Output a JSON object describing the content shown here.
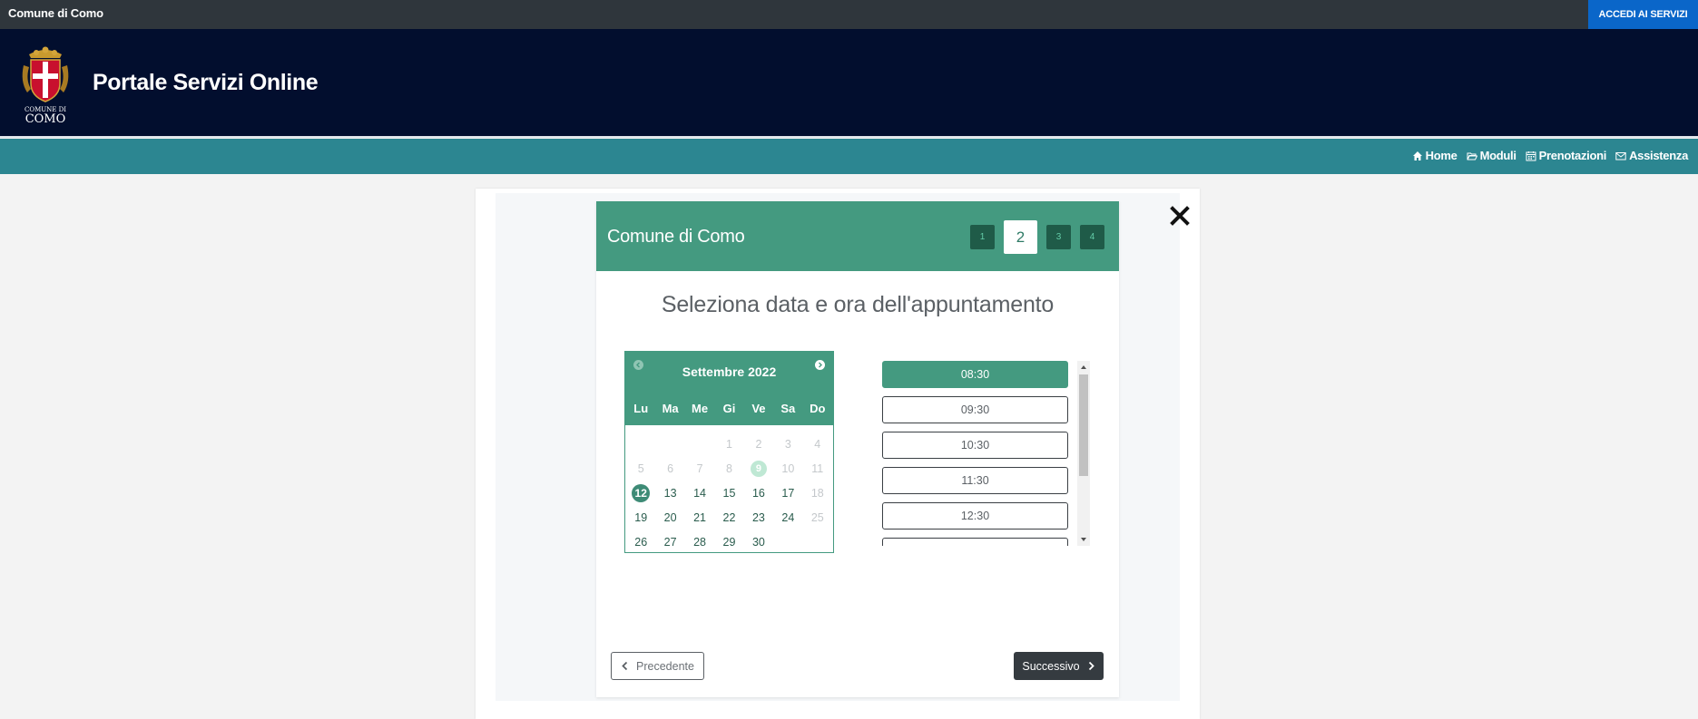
{
  "topbar": {
    "brand": "Comune di Como",
    "access_label": "ACCEDI AI SERVIZI"
  },
  "header": {
    "title": "Portale Servizi Online",
    "logo_text_1": "COMUNE DI",
    "logo_text_2": "COMO"
  },
  "nav": {
    "items": [
      {
        "label": "Home",
        "icon": "home-icon"
      },
      {
        "label": "Moduli",
        "icon": "folder-open-icon"
      },
      {
        "label": "Prenotazioni",
        "icon": "calendar-icon"
      },
      {
        "label": "Assistenza",
        "icon": "envelope-icon"
      }
    ]
  },
  "wizard": {
    "org": "Comune di Como",
    "steps": [
      "1",
      "2",
      "3",
      "4"
    ],
    "active_step": "2",
    "title": "Seleziona data e ora dell'appuntamento",
    "prev_label": "Precedente",
    "next_label": "Successivo"
  },
  "calendar": {
    "month": "Settembre 2022",
    "weekdays": [
      "Lu",
      "Ma",
      "Me",
      "Gi",
      "Ve",
      "Sa",
      "Do"
    ],
    "days": [
      {
        "d": "",
        "s": "empty"
      },
      {
        "d": "",
        "s": "empty"
      },
      {
        "d": "",
        "s": "empty"
      },
      {
        "d": "1",
        "s": "dis"
      },
      {
        "d": "2",
        "s": "dis"
      },
      {
        "d": "3",
        "s": "dis"
      },
      {
        "d": "4",
        "s": "dis"
      },
      {
        "d": "5",
        "s": "dis"
      },
      {
        "d": "6",
        "s": "dis"
      },
      {
        "d": "7",
        "s": "dis"
      },
      {
        "d": "8",
        "s": "dis"
      },
      {
        "d": "9",
        "s": "today"
      },
      {
        "d": "10",
        "s": "dis"
      },
      {
        "d": "11",
        "s": "dis"
      },
      {
        "d": "12",
        "s": "sel"
      },
      {
        "d": "13",
        "s": "on"
      },
      {
        "d": "14",
        "s": "on"
      },
      {
        "d": "15",
        "s": "on"
      },
      {
        "d": "16",
        "s": "on"
      },
      {
        "d": "17",
        "s": "on"
      },
      {
        "d": "18",
        "s": "dis"
      },
      {
        "d": "19",
        "s": "on"
      },
      {
        "d": "20",
        "s": "on"
      },
      {
        "d": "21",
        "s": "on"
      },
      {
        "d": "22",
        "s": "on"
      },
      {
        "d": "23",
        "s": "on"
      },
      {
        "d": "24",
        "s": "on"
      },
      {
        "d": "25",
        "s": "dis"
      },
      {
        "d": "26",
        "s": "on"
      },
      {
        "d": "27",
        "s": "on"
      },
      {
        "d": "28",
        "s": "on"
      },
      {
        "d": "29",
        "s": "on"
      },
      {
        "d": "30",
        "s": "on"
      }
    ]
  },
  "slots": {
    "times": [
      "08:30",
      "09:30",
      "10:30",
      "11:30",
      "12:30",
      ""
    ],
    "selected": "08:30"
  },
  "colors": {
    "accent": "#449a80",
    "header_bg": "#020e2e",
    "nav_bg": "#2c8691",
    "topbar_bg": "#2f363c",
    "access_bg": "#0a66c9"
  }
}
